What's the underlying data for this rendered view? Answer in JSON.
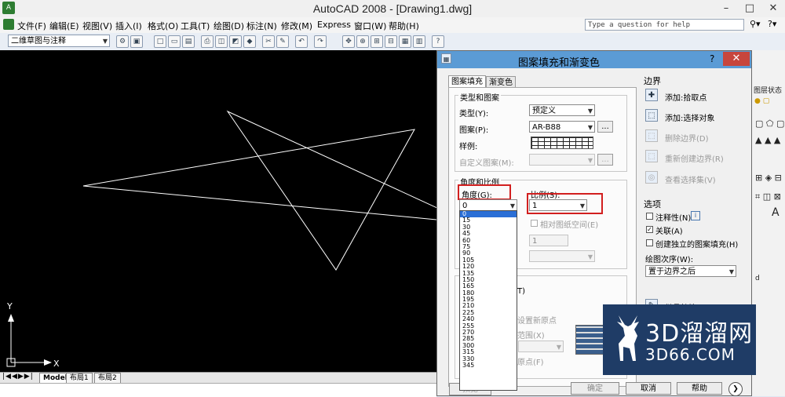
{
  "app": {
    "title": "AutoCAD 2008 - [Drawing1.dwg]",
    "icon": "autocad-logo-icon"
  },
  "menu": {
    "items": [
      "文件(F)",
      "编辑(E)",
      "视图(V)",
      "插入(I)",
      "格式(O)",
      "工具(T)",
      "绘图(D)",
      "标注(N)",
      "修改(M)",
      "Express",
      "窗口(W)",
      "帮助(H)"
    ]
  },
  "help_search": {
    "placeholder": "Type a question for help"
  },
  "toolbar": {
    "workspace": "二维草图与注释"
  },
  "drawing": {
    "ucs_x": "X",
    "ucs_y": "Y",
    "layout_tabs": [
      "Model",
      "布局1",
      "布局2"
    ]
  },
  "dialog": {
    "title": "图案填充和渐变色",
    "help": "?",
    "close": "✕",
    "tabs": [
      "图案填充",
      "渐变色"
    ],
    "type_group": {
      "title": "类型和图案",
      "type_label": "类型(Y):",
      "type_value": "预定义",
      "pattern_label": "图案(P):",
      "pattern_value": "AR-B88",
      "swatch_label": "样例:",
      "custom_label": "自定义图案(M):",
      "ellipsis": "..."
    },
    "angle_group": {
      "title": "角度和比例",
      "angle_label": "角度(G):",
      "angle_value": "0",
      "scale_label": "比例(S):",
      "scale_value": "1",
      "relative_label": "相对图纸空间(E)",
      "spacing_value": "1",
      "angle_options": [
        "0",
        "15",
        "30",
        "45",
        "60",
        "75",
        "90",
        "105",
        "120",
        "135",
        "150",
        "165",
        "180",
        "195",
        "210",
        "225",
        "240",
        "255",
        "270",
        "285",
        "300",
        "315",
        "330",
        "345"
      ]
    },
    "origin_group": {
      "fragment_t": "T)",
      "fragment_set_new": "设置新原点",
      "fragment_extent": "范围(X)",
      "fragment_origin": "原点(F)"
    },
    "boundary": {
      "title": "边界",
      "add_pick": "添加:拾取点",
      "add_select": "添加:选择对象",
      "remove": "删除边界(D)",
      "recreate": "重新创建边界(R)",
      "view": "查看选择集(V)"
    },
    "options": {
      "title": "选项",
      "annotative": "注释性(N)",
      "associative": "关联(A)",
      "separate": "创建独立的图案填充(H)",
      "draw_order_label": "绘图次序(W):",
      "draw_order_value": "置于边界之后",
      "inherit": "继承特性"
    },
    "buttons": {
      "preview": "预览",
      "ok": "确定",
      "cancel": "取消",
      "help": "帮助",
      "more": "❯"
    }
  },
  "palette": {
    "layer_state": "图层状态",
    "text_a": "A",
    "text_d": "d"
  },
  "watermark": {
    "cn": "3D溜溜网",
    "en": "3D66.COM"
  },
  "colors": {
    "dialog_title": "#5b9bd5",
    "close": "#c7463d",
    "highlight": "#d21f1f",
    "selection": "#2b6fd6",
    "watermark": "#1f3c66"
  }
}
